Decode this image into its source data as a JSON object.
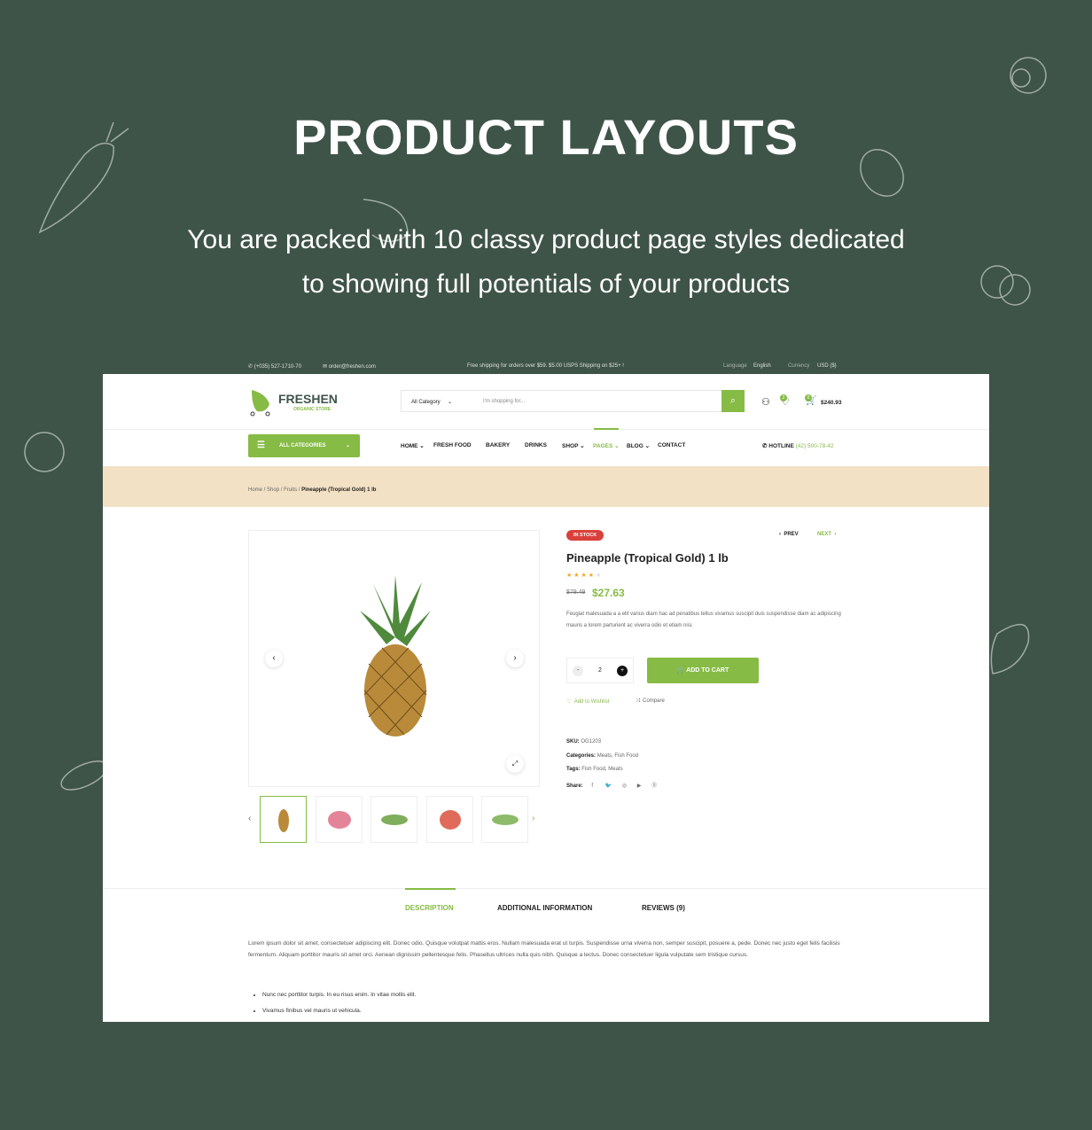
{
  "hero": {
    "title": "PRODUCT LAYOUTS",
    "subtitle_line1": "You are packed with 10 classy product page styles dedicated",
    "subtitle_line2": "to showing full potentials of your products"
  },
  "topbar": {
    "phone": "(+035) 527-1710-70",
    "email": "order@freshen.com",
    "shipping": "Free shipping for orders over $59. $5.00 USPS Shipping on $25+ !",
    "language_label": "Language",
    "language": "English",
    "currency_label": "Currency",
    "currency": "USD ($)"
  },
  "header": {
    "logo": "FRESHEN",
    "logo_sub": "ORGANIC STORE",
    "search_category": "All Category",
    "search_placeholder": "I'm shopping for...",
    "wishlist_count": "2",
    "cart_count": "0",
    "cart_total": "$240.93"
  },
  "nav": {
    "all_categories": "ALL CATEGORIES",
    "items": [
      "HOME",
      "FRESH FOOD",
      "BAKERY",
      "DRINKS",
      "SHOP",
      "PAGES",
      "BLOG",
      "CONTACT"
    ],
    "active": "PAGES",
    "hotline_label": "HOTLINE",
    "hotline": "(42) 500-78-42",
    "accent": "#86bb46"
  },
  "breadcrumb": {
    "items": [
      "Home",
      "Shop",
      "Fruits"
    ],
    "current": "Pineapple (Tropical Gold) 1 lb"
  },
  "product": {
    "stock": "IN STOCK",
    "prev": "PREV",
    "next": "NEXT",
    "title": "Pineapple (Tropical Gold) 1 lb",
    "rating": 4,
    "rating_max": 5,
    "old_price": "$79.49",
    "price": "$27.63",
    "description": "Feugiat malesuada a a elit varius diam hac ad penatibus tellus vivamus suscipit duis suspendisse diam ac adipiscing mauris a lorem parturient ac viverra odio et etiam nisi.",
    "quantity": "2",
    "add_to_cart": "ADD TO CART",
    "wishlist": "Add to Wishlist",
    "compare": "Compare",
    "sku_label": "SKU:",
    "sku": "OG1203",
    "categories_label": "Categories:",
    "categories": "Meats, Fish Food",
    "tags_label": "Tags:",
    "tags": "Fish Food, Meats",
    "share_label": "Share:"
  },
  "tabs": {
    "items": [
      "DESCRIPTION",
      "ADDITIONAL INFORMATION",
      "REVIEWS (9)"
    ],
    "active": "DESCRIPTION"
  },
  "description": {
    "text": "Lorem ipsum dolor sit amet, consectetuer adipiscing elit. Donec odio. Quisque volutpat mattis eros. Nullam malesuada erat ut turpis. Suspendisse urna viverra non, semper suscipit, posuere a, pede. Donec nec justo eget felis facilisis fermentum. Aliquam porttitor mauris sit amet orci. Aenean dignissim pellentesque felis. Phasellus ultrices nulla quis nibh. Quisque a lectus. Donec consectetuer ligula vulputate sem tristique cursus.",
    "bullets": [
      "Nunc nec porttitor turpis. In eu risus enim. In vitae mollis elit.",
      "Vivamus finibus vel mauris ut vehicula."
    ]
  }
}
